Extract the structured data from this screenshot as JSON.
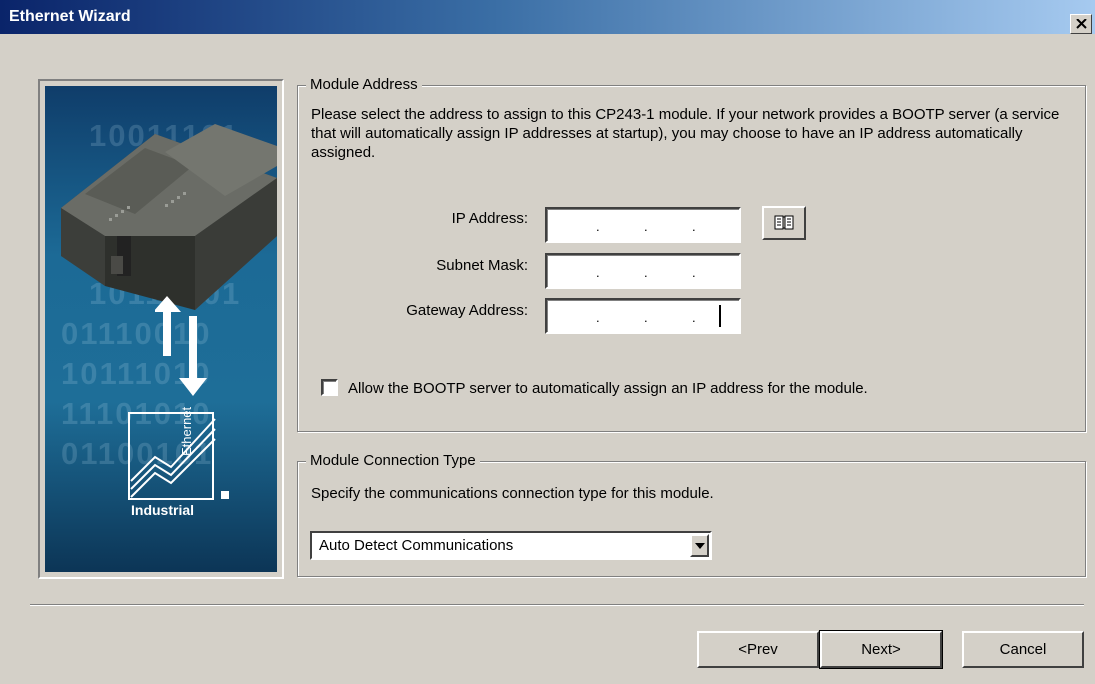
{
  "window": {
    "title": "Ethernet Wizard",
    "close_symbol": "×"
  },
  "module_address": {
    "group_title": "Module Address",
    "description": "Please select the address to assign to this CP243-1 module. If your network provides a BOOTP server (a service that will automatically assign IP addresses at startup), you may choose to have an IP address automatically assigned.",
    "ip_label": "IP Address:",
    "subnet_label": "Subnet Mask:",
    "gateway_label": "Gateway Address:",
    "ip_separator": ".",
    "bootp_label": "Allow the BOOTP server to automatically assign an IP address for the module.",
    "bootp_checked": false
  },
  "connection_type": {
    "group_title": "Module Connection Type",
    "description": "Specify the communications connection type for this module.",
    "selected": "Auto Detect Communications"
  },
  "buttons": {
    "prev": "<Prev",
    "next": "Next>",
    "cancel": "Cancel"
  },
  "art": {
    "binary_rows": [
      "10011101",
      "10110101",
      "01110010",
      "10111010",
      "11101010",
      "01100101"
    ],
    "logo_text": "Industrial",
    "logo_vertical": "Ethernet"
  }
}
